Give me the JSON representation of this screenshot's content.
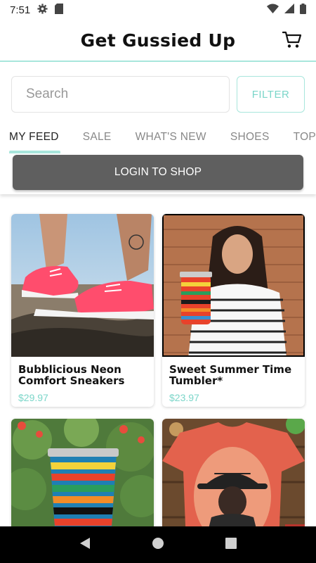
{
  "status": {
    "time": "7:51"
  },
  "header": {
    "title": "Get Gussied Up"
  },
  "search": {
    "placeholder": "Search",
    "filter_label": "FILTER"
  },
  "tabs": [
    {
      "label": "MY FEED",
      "active": true
    },
    {
      "label": "SALE",
      "active": false
    },
    {
      "label": "WHAT'S NEW",
      "active": false
    },
    {
      "label": "SHOES",
      "active": false
    },
    {
      "label": "TOPS",
      "active": false
    }
  ],
  "login": {
    "label": "LOGIN TO SHOP"
  },
  "products": [
    {
      "title": "Bubblicious Neon Comfort Sneakers",
      "price": "$29.97"
    },
    {
      "title": "Sweet Summer Time Tumbler*",
      "price": "$23.97"
    },
    {
      "title": "",
      "price": ""
    },
    {
      "title": "",
      "price": ""
    }
  ],
  "colors": {
    "accent": "#a8e6dc",
    "price": "#7bd6c9",
    "login_bg": "#5f5f5f"
  }
}
